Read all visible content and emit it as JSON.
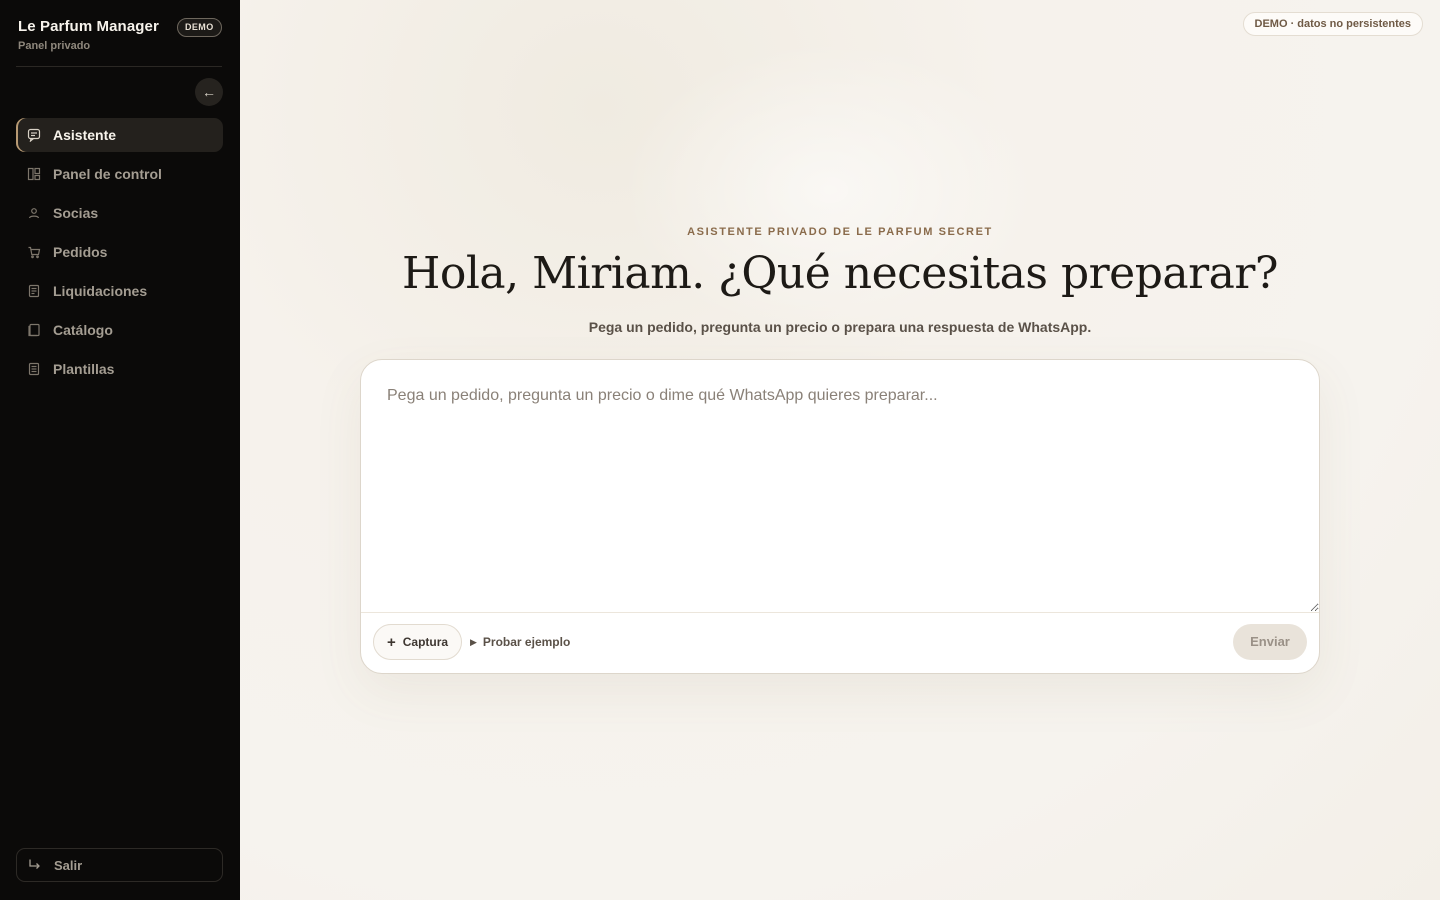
{
  "sidebar": {
    "brand_title": "Le Parfum Manager",
    "brand_subtitle": "Panel privado",
    "demo_pill": "DEMO",
    "collapse_icon": "arrow-left-icon",
    "items": [
      {
        "label": "Asistente",
        "icon": "chat-icon",
        "active": true
      },
      {
        "label": "Panel de control",
        "icon": "dashboard-icon",
        "active": false
      },
      {
        "label": "Socias",
        "icon": "user-icon",
        "active": false
      },
      {
        "label": "Pedidos",
        "icon": "cart-icon",
        "active": false
      },
      {
        "label": "Liquidaciones",
        "icon": "receipt-icon",
        "active": false
      },
      {
        "label": "Catálogo",
        "icon": "book-icon",
        "active": false
      },
      {
        "label": "Plantillas",
        "icon": "document-icon",
        "active": false
      }
    ],
    "logout_label": "Salir",
    "logout_icon": "logout-icon"
  },
  "main": {
    "demo_badge": "DEMO · datos no persistentes",
    "eyebrow": "ASISTENTE PRIVADO DE LE PARFUM SECRET",
    "headline": "Hola, Miriam. ¿Qué necesitas preparar?",
    "subtitle": "Pega un pedido, pregunta un precio o prepara una respuesta de WhatsApp.",
    "composer": {
      "placeholder": "Pega un pedido, pregunta un precio o dime qué WhatsApp quieres preparar...",
      "value": "",
      "capture_label": "Captura",
      "example_label": "Probar ejemplo",
      "send_label": "Enviar"
    }
  },
  "colors": {
    "sidebar_bg": "#0b0a09",
    "accent": "#b89a74",
    "eyebrow": "#8a6b4b",
    "main_bg": "#f6f3ee"
  }
}
